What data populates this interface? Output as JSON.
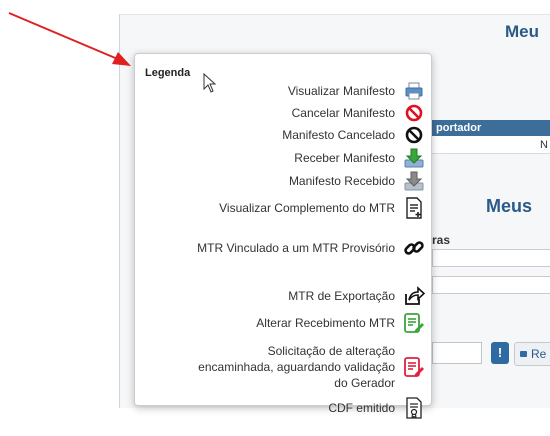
{
  "background": {
    "page_title": "Meu",
    "section_title": "Meus",
    "table_header": "portador",
    "table_cell": "N",
    "field_label": "ras",
    "search_button_label": "Re",
    "info_button_label": "!"
  },
  "legend": {
    "title": "Legenda",
    "items": [
      {
        "label": "Visualizar Manifesto",
        "icon": "printer-icon"
      },
      {
        "label": "Cancelar Manifesto",
        "icon": "cancel-red-icon"
      },
      {
        "label": "Manifesto Cancelado",
        "icon": "cancel-black-icon"
      },
      {
        "label": "Receber Manifesto",
        "icon": "download-green-icon"
      },
      {
        "label": "Manifesto Recebido",
        "icon": "download-gray-icon"
      },
      {
        "label": "Visualizar Complemento do MTR",
        "icon": "document-plus-icon"
      },
      {
        "label": "MTR Vinculado a um MTR Provisório",
        "icon": "link-icon"
      },
      {
        "label": "MTR de Exportação",
        "icon": "export-icon"
      },
      {
        "label": "Alterar Recebimento MTR",
        "icon": "edit-document-green-icon"
      },
      {
        "label": "Solicitação de alteração encaminhada, aguardando validação do Gerador",
        "icon": "edit-document-red-icon"
      },
      {
        "label": "CDF emitido",
        "icon": "certificate-icon"
      }
    ]
  },
  "colors": {
    "accent": "#2a5a8a",
    "annotation_arrow": "#e02020"
  }
}
